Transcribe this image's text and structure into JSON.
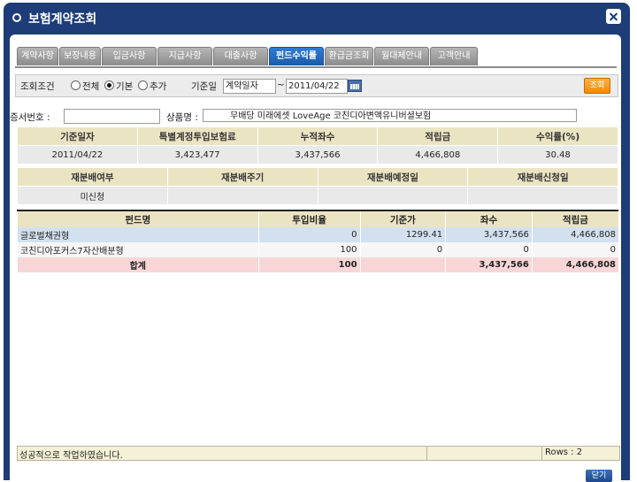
{
  "window": {
    "title": "보험계약조회"
  },
  "tabs": [
    {
      "label": "계약사항"
    },
    {
      "label": "보장내용"
    },
    {
      "label": "입금사항"
    },
    {
      "label": "지급사항"
    },
    {
      "label": "대출사항"
    },
    {
      "label": "펀드수익률",
      "active": true
    },
    {
      "label": "환급금조회"
    },
    {
      "label": "월대체안내"
    },
    {
      "label": "고객안내"
    }
  ],
  "condition": {
    "label": "조회조건",
    "options": [
      {
        "label": "전체",
        "checked": false
      },
      {
        "label": "기본",
        "checked": true
      },
      {
        "label": "추가",
        "checked": false
      }
    ],
    "date_label": "기준일",
    "date_type": "계약일자",
    "tilde": "~",
    "date_value": "2011/04/22",
    "search_label": "조회"
  },
  "policy": {
    "cert_label": "증서번호 :",
    "cert_value": "",
    "product_label": "상품명 :",
    "product_value": "무배당 미래에셋 LoveAge 코친디아변액유니버셜보험"
  },
  "summary": {
    "headers": [
      "기준일자",
      "특별계정투입보험료",
      "누적좌수",
      "적립금",
      "수익률(%)"
    ],
    "values": [
      "2011/04/22",
      "3,423,477",
      "3,437,566",
      "4,466,808",
      "30.48"
    ]
  },
  "redistribution": {
    "headers": [
      "재분배여부",
      "재분배주기",
      "재분배예정일",
      "재분배신청일"
    ],
    "values": [
      "미신청",
      "",
      "",
      ""
    ]
  },
  "fund_table": {
    "headers": [
      "펀드명",
      "투입비율",
      "기준가",
      "좌수",
      "적립금"
    ],
    "rows": [
      [
        "글로벌채권형",
        "0",
        "1299.41",
        "3,437,566",
        "4,466,808"
      ],
      [
        "코친디아포커스7자산배분형",
        "100",
        "0",
        "0",
        "0"
      ]
    ],
    "total": [
      "합계",
      "100",
      "",
      "3,437,566",
      "4,466,808"
    ]
  },
  "status": {
    "message": "성공적으로 작업하였습니다.",
    "rows": "Rows : 2"
  },
  "footer": {
    "close_label": "닫기"
  },
  "colors": {
    "title_bar": "#1d3c78",
    "active_tab": "#2e7bd6",
    "header": "#ebe4c3",
    "total_row": "#f8d6d8",
    "search_button": "#f08a00"
  }
}
